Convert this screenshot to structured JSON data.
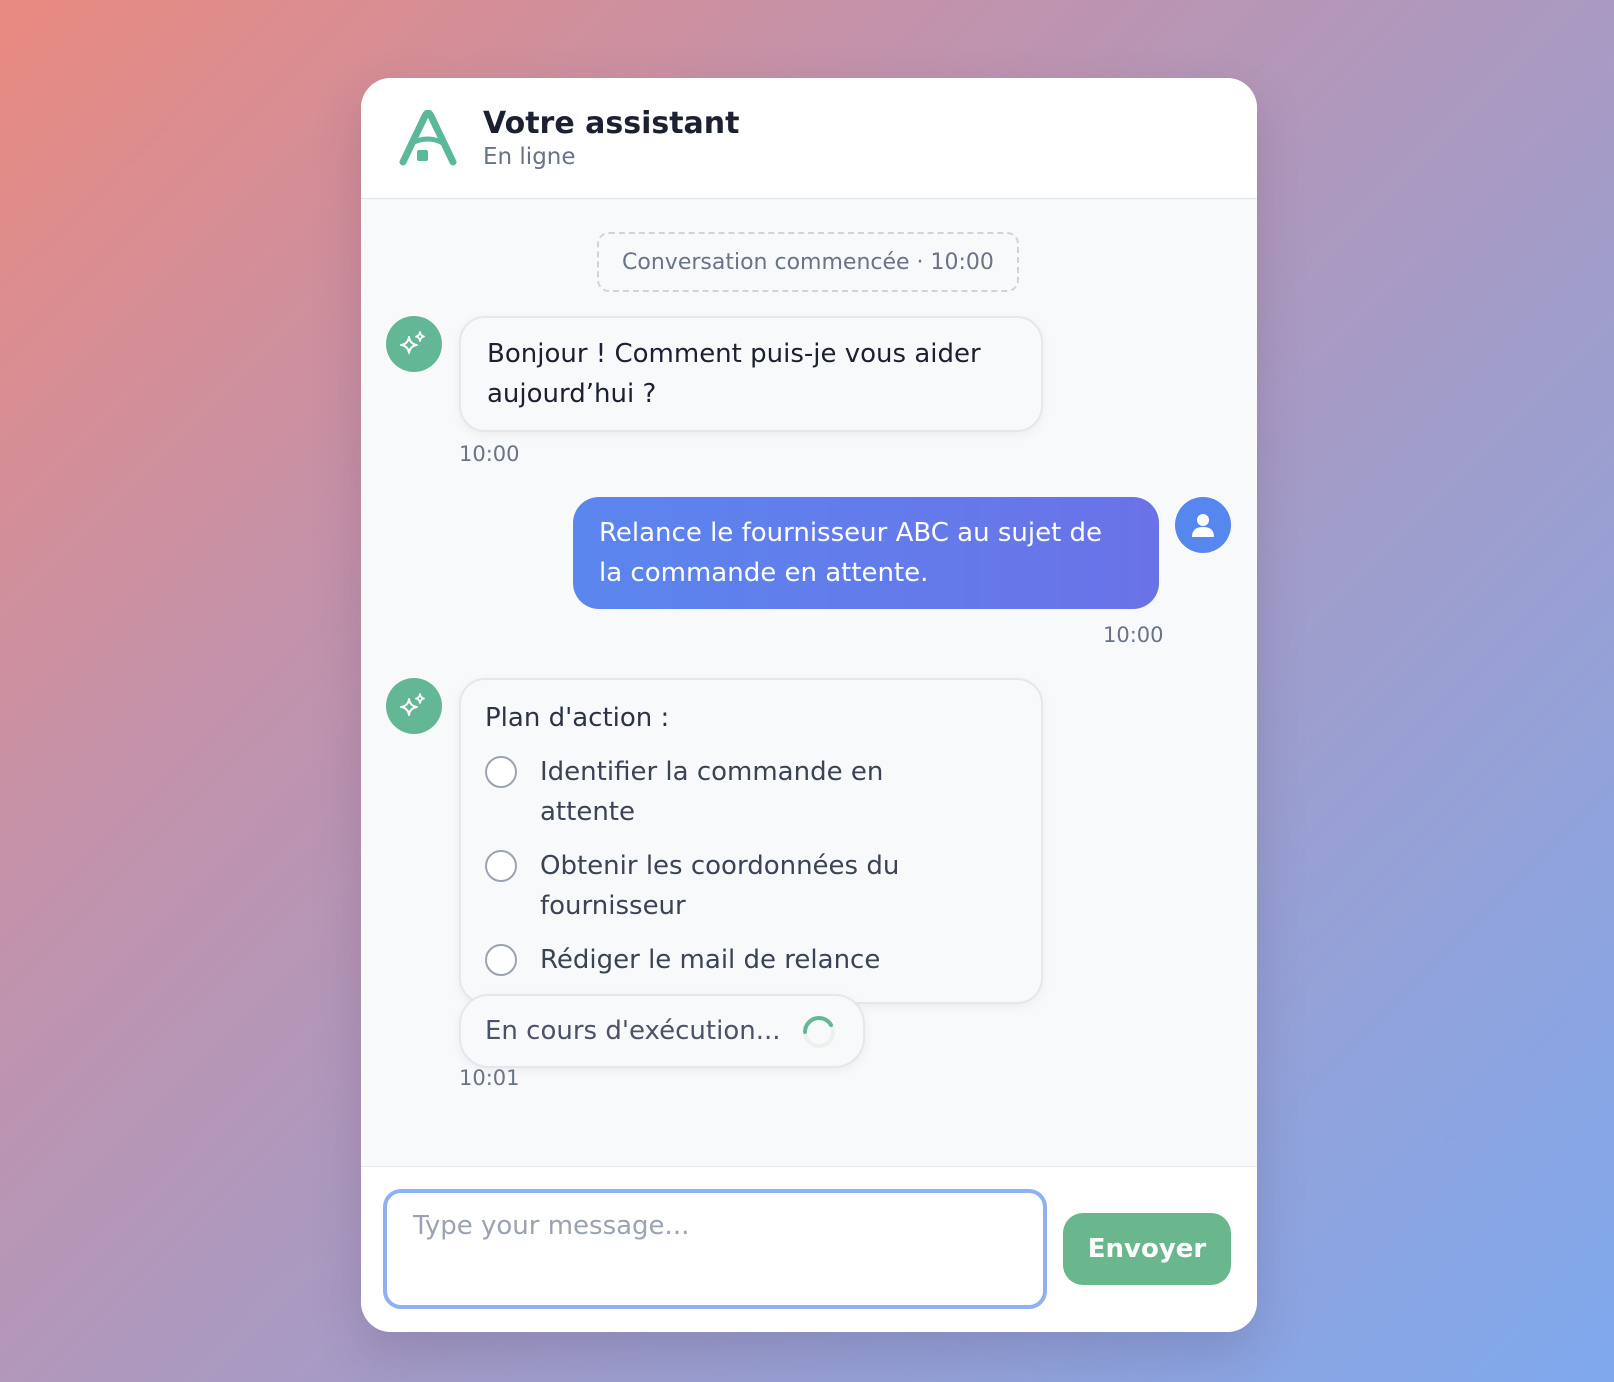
{
  "header": {
    "title": "Votre assistant",
    "status": "En ligne",
    "logo_icon": "letter-a-logo",
    "logo_color": "#5bb89b"
  },
  "system": {
    "started": "Conversation commencée · 10:00"
  },
  "messages": [
    {
      "role": "assistant",
      "text": "Bonjour ! Comment puis-je vous aider aujourd’hui ?",
      "time": "10:00",
      "avatar_icon": "sparkle-icon"
    },
    {
      "role": "user",
      "text": "Relance le fournisseur ABC au sujet de la commande en attente.",
      "time": "10:00",
      "avatar_icon": "user-icon"
    },
    {
      "role": "assistant",
      "plan_title": "Plan d'action :",
      "plan_items": [
        "Identifier la commande en attente",
        "Obtenir les coordonnées du fournisseur",
        "Rédiger le mail de relance"
      ],
      "status": "En cours d'exécution...",
      "time": "10:01",
      "avatar_icon": "sparkle-icon"
    }
  ],
  "composer": {
    "placeholder": "Type your message...",
    "value": "",
    "send_label": "Envoyer"
  },
  "colors": {
    "bot_avatar": "#63b794",
    "user_avatar": "#5587ee",
    "user_bubble": "#5b86ee",
    "send_button": "#6bb78d",
    "input_focus": "#8fb0f1"
  }
}
